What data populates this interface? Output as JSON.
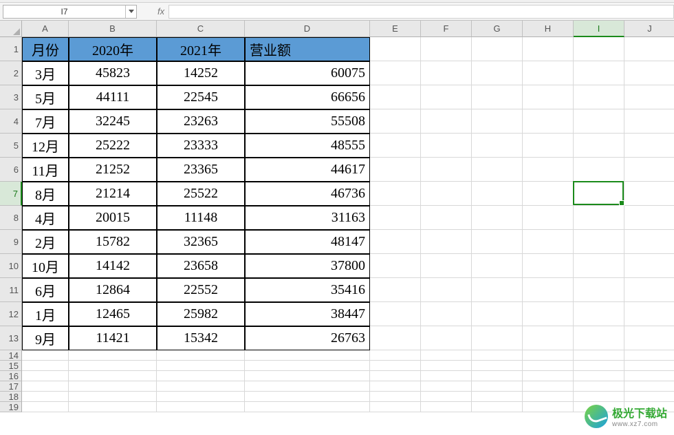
{
  "cellRef": "I7",
  "fxLabel": "fx",
  "fxValue": "",
  "columns": [
    {
      "label": "A",
      "cls": "cA"
    },
    {
      "label": "B",
      "cls": "cB"
    },
    {
      "label": "C",
      "cls": "cC"
    },
    {
      "label": "D",
      "cls": "cD"
    },
    {
      "label": "E",
      "cls": "cE"
    },
    {
      "label": "F",
      "cls": "cF"
    },
    {
      "label": "G",
      "cls": "cG"
    },
    {
      "label": "H",
      "cls": "cH"
    },
    {
      "label": "I",
      "cls": "cI",
      "active": true
    },
    {
      "label": "J",
      "cls": "cJ"
    }
  ],
  "rowNumbers": [
    1,
    2,
    3,
    4,
    5,
    6,
    7,
    8,
    9,
    10,
    11,
    12,
    13,
    14,
    15,
    16,
    17,
    18,
    19
  ],
  "activeRow": 7,
  "tallRows": 13,
  "header": {
    "a": "月份",
    "b": "2020年",
    "c": "2021年",
    "d": "营业额"
  },
  "data": [
    {
      "a": "3月",
      "b": "45823",
      "c": "14252",
      "d": "60075"
    },
    {
      "a": "5月",
      "b": "44111",
      "c": "22545",
      "d": "66656"
    },
    {
      "a": "7月",
      "b": "32245",
      "c": "23263",
      "d": "55508"
    },
    {
      "a": "12月",
      "b": "25222",
      "c": "23333",
      "d": "48555"
    },
    {
      "a": "11月",
      "b": "21252",
      "c": "23365",
      "d": "44617"
    },
    {
      "a": "8月",
      "b": "21214",
      "c": "25522",
      "d": "46736"
    },
    {
      "a": "4月",
      "b": "20015",
      "c": "11148",
      "d": "31163"
    },
    {
      "a": "2月",
      "b": "15782",
      "c": "32365",
      "d": "48147"
    },
    {
      "a": "10月",
      "b": "14142",
      "c": "23658",
      "d": "37800"
    },
    {
      "a": "6月",
      "b": "12864",
      "c": "22552",
      "d": "35416"
    },
    {
      "a": "1月",
      "b": "12465",
      "c": "25982",
      "d": "38447"
    },
    {
      "a": "9月",
      "b": "11421",
      "c": "15342",
      "d": "26763"
    }
  ],
  "watermark": {
    "text": "极光下载站",
    "sub": "www.xz7.com"
  },
  "chart_data": {
    "type": "table",
    "title": "",
    "columns": [
      "月份",
      "2020年",
      "2021年",
      "营业额"
    ],
    "rows": [
      [
        "3月",
        45823,
        14252,
        60075
      ],
      [
        "5月",
        44111,
        22545,
        66656
      ],
      [
        "7月",
        32245,
        23263,
        55508
      ],
      [
        "12月",
        25222,
        23333,
        48555
      ],
      [
        "11月",
        21252,
        23365,
        44617
      ],
      [
        "8月",
        21214,
        25522,
        46736
      ],
      [
        "4月",
        20015,
        11148,
        31163
      ],
      [
        "2月",
        15782,
        32365,
        48147
      ],
      [
        "10月",
        14142,
        23658,
        37800
      ],
      [
        "6月",
        12864,
        22552,
        35416
      ],
      [
        "1月",
        12465,
        25982,
        38447
      ],
      [
        "9月",
        11421,
        15342,
        26763
      ]
    ]
  }
}
